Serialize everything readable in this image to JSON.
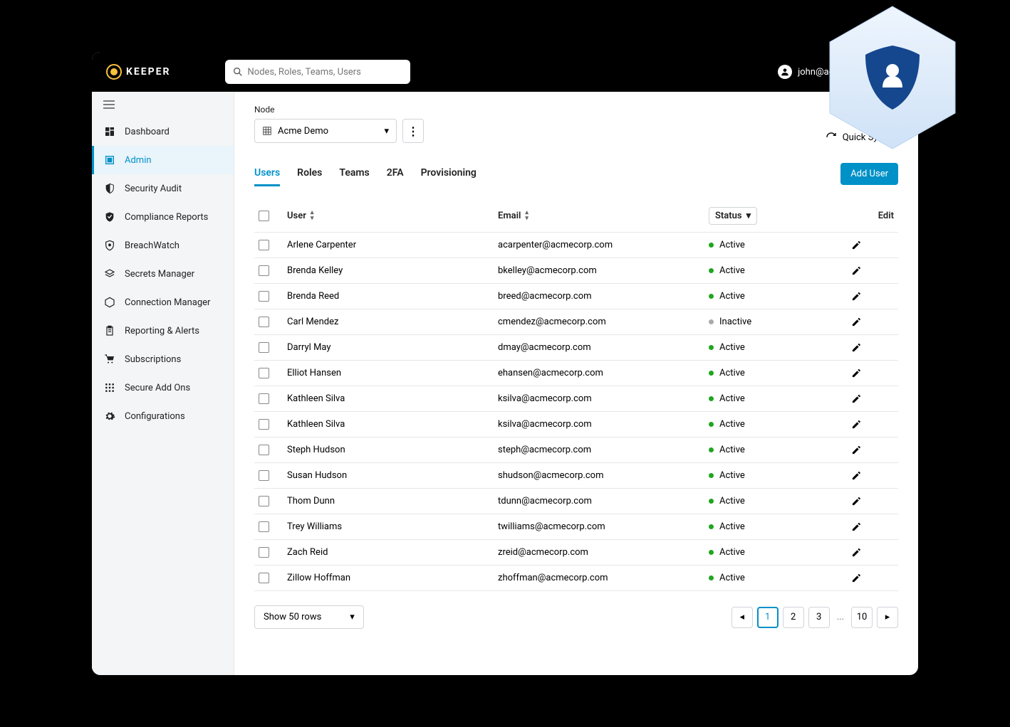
{
  "brand": "KEEPER",
  "search": {
    "placeholder": "Nodes, Roles, Teams, Users"
  },
  "account": {
    "email": "john@acme-demo.com"
  },
  "sidebar": {
    "items": [
      {
        "label": "Dashboard",
        "icon": "dashboard-icon"
      },
      {
        "label": "Admin",
        "icon": "admin-icon",
        "active": true
      },
      {
        "label": "Security Audit",
        "icon": "shield-half-icon"
      },
      {
        "label": "Compliance Reports",
        "icon": "shield-check-icon"
      },
      {
        "label": "BreachWatch",
        "icon": "shield-eye-icon"
      },
      {
        "label": "Secrets Manager",
        "icon": "layers-icon"
      },
      {
        "label": "Connection Manager",
        "icon": "hex-icon"
      },
      {
        "label": "Reporting & Alerts",
        "icon": "clipboard-icon"
      },
      {
        "label": "Subscriptions",
        "icon": "cart-icon"
      },
      {
        "label": "Secure Add Ons",
        "icon": "grid-icon"
      },
      {
        "label": "Configurations",
        "icon": "gear-icon"
      }
    ]
  },
  "node": {
    "label": "Node",
    "selected": "Acme Demo"
  },
  "quick_sync": "Quick Sync",
  "tabs": [
    "Users",
    "Roles",
    "Teams",
    "2FA",
    "Provisioning"
  ],
  "active_tab": 0,
  "add_user_label": "Add User",
  "columns": {
    "user": "User",
    "email": "Email",
    "status": "Status",
    "edit": "Edit"
  },
  "rows": [
    {
      "name": "Arlene Carpenter",
      "email": "acarpenter@acmecorp.com",
      "status": "Active"
    },
    {
      "name": "Brenda Kelley",
      "email": "bkelley@acmecorp.com",
      "status": "Active"
    },
    {
      "name": "Brenda Reed",
      "email": "breed@acmecorp.com",
      "status": "Active"
    },
    {
      "name": "Carl Mendez",
      "email": "cmendez@acmecorp.com",
      "status": "Inactive"
    },
    {
      "name": "Darryl May",
      "email": "dmay@acmecorp.com",
      "status": "Active"
    },
    {
      "name": "Elliot Hansen",
      "email": "ehansen@acmecorp.com",
      "status": "Active"
    },
    {
      "name": "Kathleen Silva",
      "email": "ksilva@acmecorp.com",
      "status": "Active"
    },
    {
      "name": "Kathleen Silva",
      "email": "ksilva@acmecorp.com",
      "status": "Active"
    },
    {
      "name": "Steph Hudson",
      "email": "steph@acmecorp.com",
      "status": "Active"
    },
    {
      "name": "Susan Hudson",
      "email": "shudson@acmecorp.com",
      "status": "Active"
    },
    {
      "name": "Thom Dunn",
      "email": "tdunn@acmecorp.com",
      "status": "Active"
    },
    {
      "name": "Trey Williams",
      "email": "twilliams@acmecorp.com",
      "status": "Active"
    },
    {
      "name": "Zach Reid",
      "email": "zreid@acmecorp.com",
      "status": "Active"
    },
    {
      "name": "Zillow Hoffman",
      "email": "zhoffman@acmecorp.com",
      "status": "Active"
    }
  ],
  "rows_per_page": "Show 50 rows",
  "pages": [
    "1",
    "2",
    "3",
    "10"
  ],
  "current_page": "1"
}
